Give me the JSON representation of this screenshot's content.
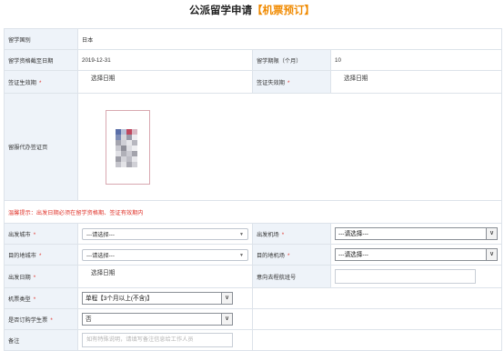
{
  "page": {
    "title_main": "公派留学申请",
    "title_highlight": "【机票预订】"
  },
  "form": {
    "country_label": "留学国别",
    "country_value": "日本",
    "qual_end_label": "留学资格截至日期",
    "qual_end_value": "2019-12-31",
    "period_label": "留学期限（个月）",
    "period_value": "10",
    "visa_start_label": "签证生效期",
    "visa_start_value": "选择日期",
    "visa_end_label": "签证失效期",
    "visa_end_value": "选择日期",
    "visa_page_label": "留服代办签证页",
    "required_mark": "*",
    "warning": "温馨提示：出发日期必须在留学资格期、签证有效期内",
    "depart_city_label": "出发城市",
    "depart_city_value": "---请选择---",
    "depart_airport_label": "出发机场",
    "depart_airport_value": "---请选择---",
    "dest_city_label": "目的地城市",
    "dest_city_value": "---请选择---",
    "dest_airport_label": "目的地机场",
    "dest_airport_value": "---请选择---",
    "depart_date_label": "出发日期",
    "depart_date_value": "选择日期",
    "flight_label": "意向去程航班号",
    "flight_value": "",
    "ticket_type_label": "机票类型",
    "ticket_type_value": "单程【3个月以上(不含)】",
    "student_ticket_label": "是否订购学生票",
    "student_ticket_value": "否",
    "notes_label": "备注",
    "notes_placeholder": "如有特殊说明，请填写备注信息给工作人员"
  },
  "icons": {
    "caret": "▼",
    "select_arrow": "∨"
  },
  "colors": {
    "accent": "#f08a00",
    "required": "#e0342b",
    "label_bg": "#eef3f9"
  }
}
